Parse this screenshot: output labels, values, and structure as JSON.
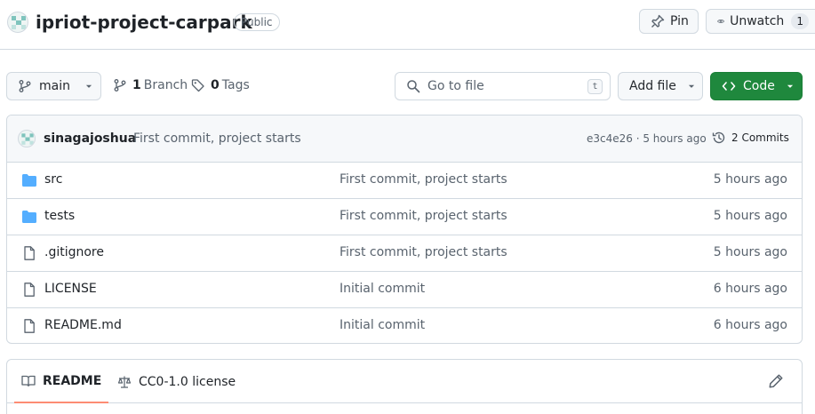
{
  "repo": {
    "name": "ipriot-project-carpark",
    "visibility": "Public"
  },
  "actions": {
    "pin_label": "Pin",
    "watch_label": "Unwatch",
    "watch_count": "1"
  },
  "toolbar": {
    "branch_name": "main",
    "branch_count": "1",
    "branch_label": "Branch",
    "tag_count": "0",
    "tag_label": "Tags",
    "search_placeholder": "Go to file",
    "search_shortcut": "t",
    "add_file_label": "Add file",
    "code_label": "Code"
  },
  "latest_commit": {
    "author": "sinagajoshua",
    "message": "First commit, project starts",
    "meta": "e3c4e26 · 5 hours ago",
    "commits_label": "2 Commits"
  },
  "files": [
    {
      "name": "src",
      "type": "folder",
      "commit": "First commit, project starts",
      "age": "5 hours ago"
    },
    {
      "name": "tests",
      "type": "folder",
      "commit": "First commit, project starts",
      "age": "5 hours ago"
    },
    {
      "name": ".gitignore",
      "type": "file",
      "commit": "First commit, project starts",
      "age": "5 hours ago"
    },
    {
      "name": "LICENSE",
      "type": "file",
      "commit": "Initial commit",
      "age": "6 hours ago"
    },
    {
      "name": "README.md",
      "type": "file",
      "commit": "Initial commit",
      "age": "6 hours ago"
    }
  ],
  "readme": {
    "tab_label": "README",
    "license_label": "CC0-1.0 license"
  },
  "colors": {
    "accent_green": "#1f883d",
    "folder_blue": "#54aeff",
    "tab_underline": "#fd8c73"
  }
}
